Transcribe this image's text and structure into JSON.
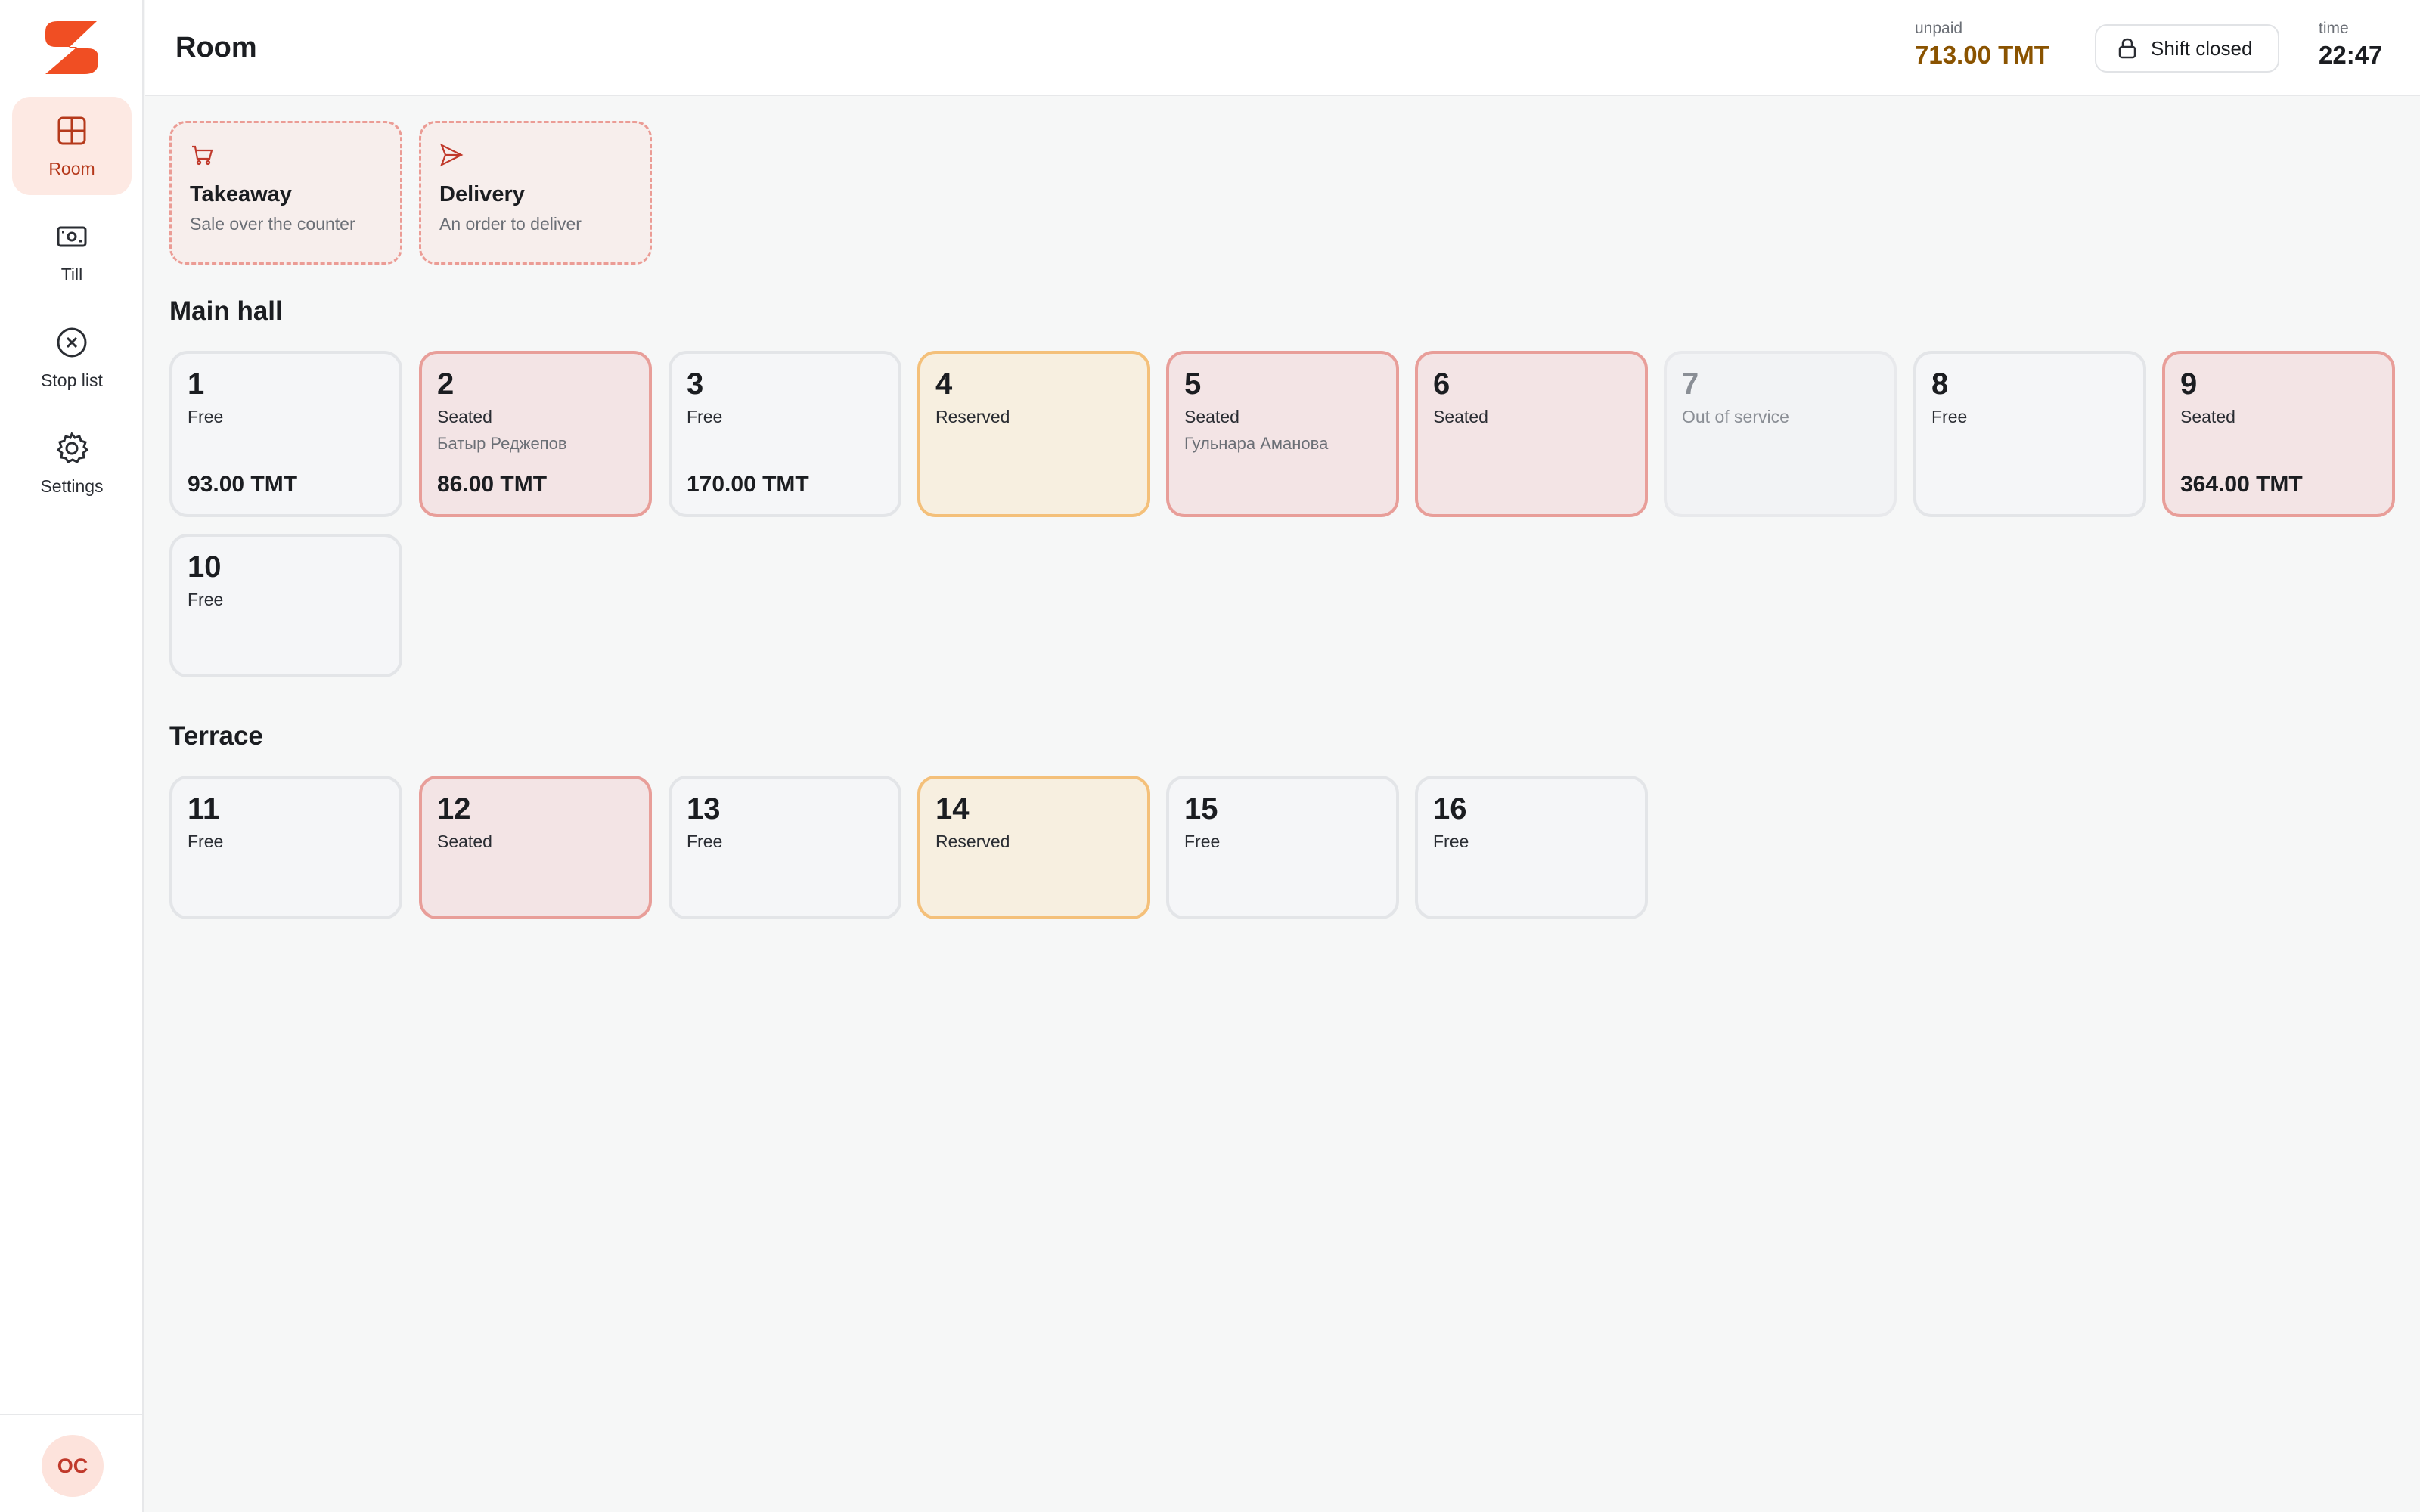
{
  "sidebar": {
    "items": [
      {
        "label": "Room",
        "icon": "grid-icon",
        "active": true
      },
      {
        "label": "Till",
        "icon": "cash-register-icon",
        "active": false
      },
      {
        "label": "Stop list",
        "icon": "circle-x-icon",
        "active": false
      },
      {
        "label": "Settings",
        "icon": "gear-icon",
        "active": false
      }
    ],
    "user_initials": "OC"
  },
  "header": {
    "title": "Room",
    "unpaid_label": "unpaid",
    "unpaid_value": "713.00 TMT",
    "shift_label": "Shift closed",
    "time_label": "time",
    "time_value": "22:47"
  },
  "quick_orders": [
    {
      "title": "Takeaway",
      "subtitle": "Sale over the counter",
      "icon": "cart-icon"
    },
    {
      "title": "Delivery",
      "subtitle": "An order to deliver",
      "icon": "send-icon"
    }
  ],
  "sections": [
    {
      "title": "Main hall",
      "tables": [
        {
          "number": "1",
          "status": "Free",
          "guest": "",
          "amount": "93.00 TMT"
        },
        {
          "number": "2",
          "status": "Seated",
          "guest": "Батыр Реджепов",
          "amount": "86.00 TMT"
        },
        {
          "number": "3",
          "status": "Free",
          "guest": "",
          "amount": "170.00 TMT"
        },
        {
          "number": "4",
          "status": "Reserved",
          "guest": "",
          "amount": ""
        },
        {
          "number": "5",
          "status": "Seated",
          "guest": "Гульнара Аманова",
          "amount": ""
        },
        {
          "number": "6",
          "status": "Seated",
          "guest": "",
          "amount": ""
        },
        {
          "number": "7",
          "status": "Out of service",
          "guest": "",
          "amount": ""
        },
        {
          "number": "8",
          "status": "Free",
          "guest": "",
          "amount": ""
        },
        {
          "number": "9",
          "status": "Seated",
          "guest": "",
          "amount": "364.00 TMT"
        },
        {
          "number": "10",
          "status": "Free",
          "guest": "",
          "amount": ""
        }
      ]
    },
    {
      "title": "Terrace",
      "tables": [
        {
          "number": "11",
          "status": "Free",
          "guest": "",
          "amount": ""
        },
        {
          "number": "12",
          "status": "Seated",
          "guest": "",
          "amount": ""
        },
        {
          "number": "13",
          "status": "Free",
          "guest": "",
          "amount": ""
        },
        {
          "number": "14",
          "status": "Reserved",
          "guest": "",
          "amount": ""
        },
        {
          "number": "15",
          "status": "Free",
          "guest": "",
          "amount": ""
        },
        {
          "number": "16",
          "status": "Free",
          "guest": "",
          "amount": ""
        }
      ]
    }
  ],
  "colors": {
    "accent": "#f04e23",
    "seated_bg": "#f3e4e5",
    "seated_border": "#e89e99",
    "reserved_bg": "#f7efe0",
    "reserved_border": "#f4c07a",
    "unpaid_text": "#8a5300"
  }
}
